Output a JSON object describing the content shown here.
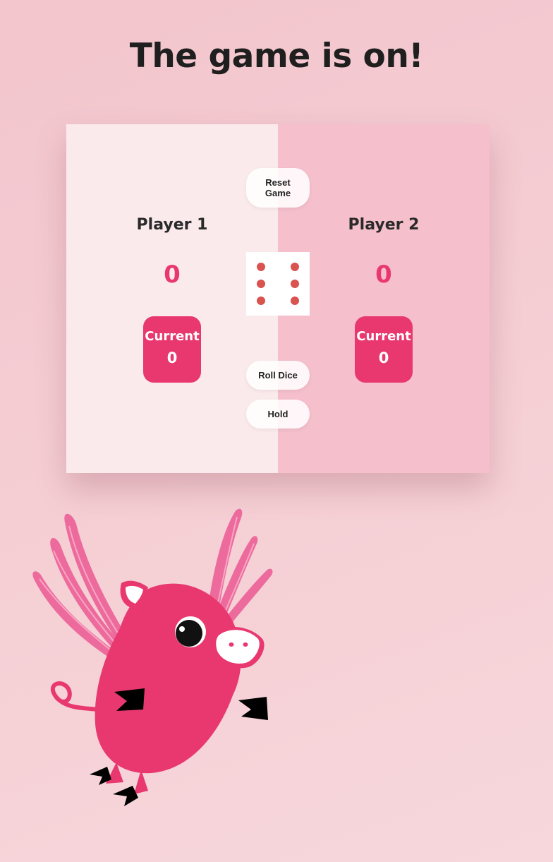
{
  "title": "The game is on!",
  "players": [
    {
      "name": "Player 1",
      "score": "0",
      "current_label": "Current",
      "current_value": "0",
      "active": true
    },
    {
      "name": "Player 2",
      "score": "0",
      "current_label": "Current",
      "current_value": "0",
      "active": false
    }
  ],
  "buttons": {
    "reset": "Reset Game",
    "roll": "Roll Dice",
    "hold": "Hold"
  },
  "dice": {
    "value": 6,
    "pip_color": "#d9534f"
  },
  "colors": {
    "accent": "#e8386f",
    "active_panel": "#fbeaec",
    "inactive_panel": "#f5bfcc"
  },
  "illustration": {
    "icon": "flying-pig-icon"
  }
}
